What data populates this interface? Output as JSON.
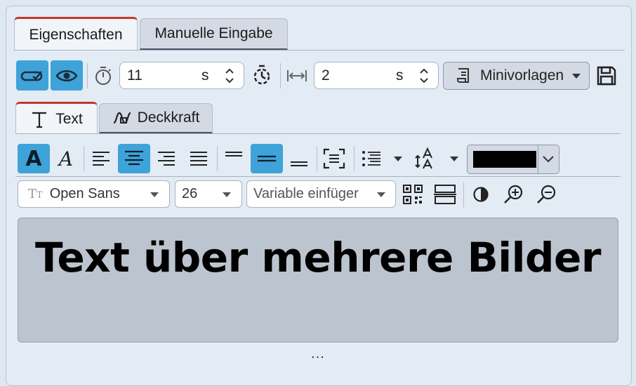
{
  "tabs": [
    {
      "label": "Eigenschaften",
      "active": true
    },
    {
      "label": "Manuelle Eingabe",
      "active": false
    }
  ],
  "toolbar": {
    "duration_value": "11",
    "duration_unit": "s",
    "spacing_value": "2",
    "spacing_unit": "s",
    "templates_label": "Minivorlagen"
  },
  "subtabs": [
    {
      "label": "Text",
      "active": true
    },
    {
      "label": "Deckkraft",
      "active": false
    }
  ],
  "format": {
    "text_color": "#000000",
    "font_family": "Open Sans",
    "font_size": "26",
    "variable_placeholder": "Variable einfüger"
  },
  "preview": {
    "text": "Text über mehrere Bilder"
  },
  "footer": {
    "more": "..."
  },
  "colors": {
    "accent": "#3ea3d8",
    "tab_accent": "#c0392b",
    "panel_bg": "#e3ebf5",
    "preview_bg": "#bcc4cf"
  }
}
